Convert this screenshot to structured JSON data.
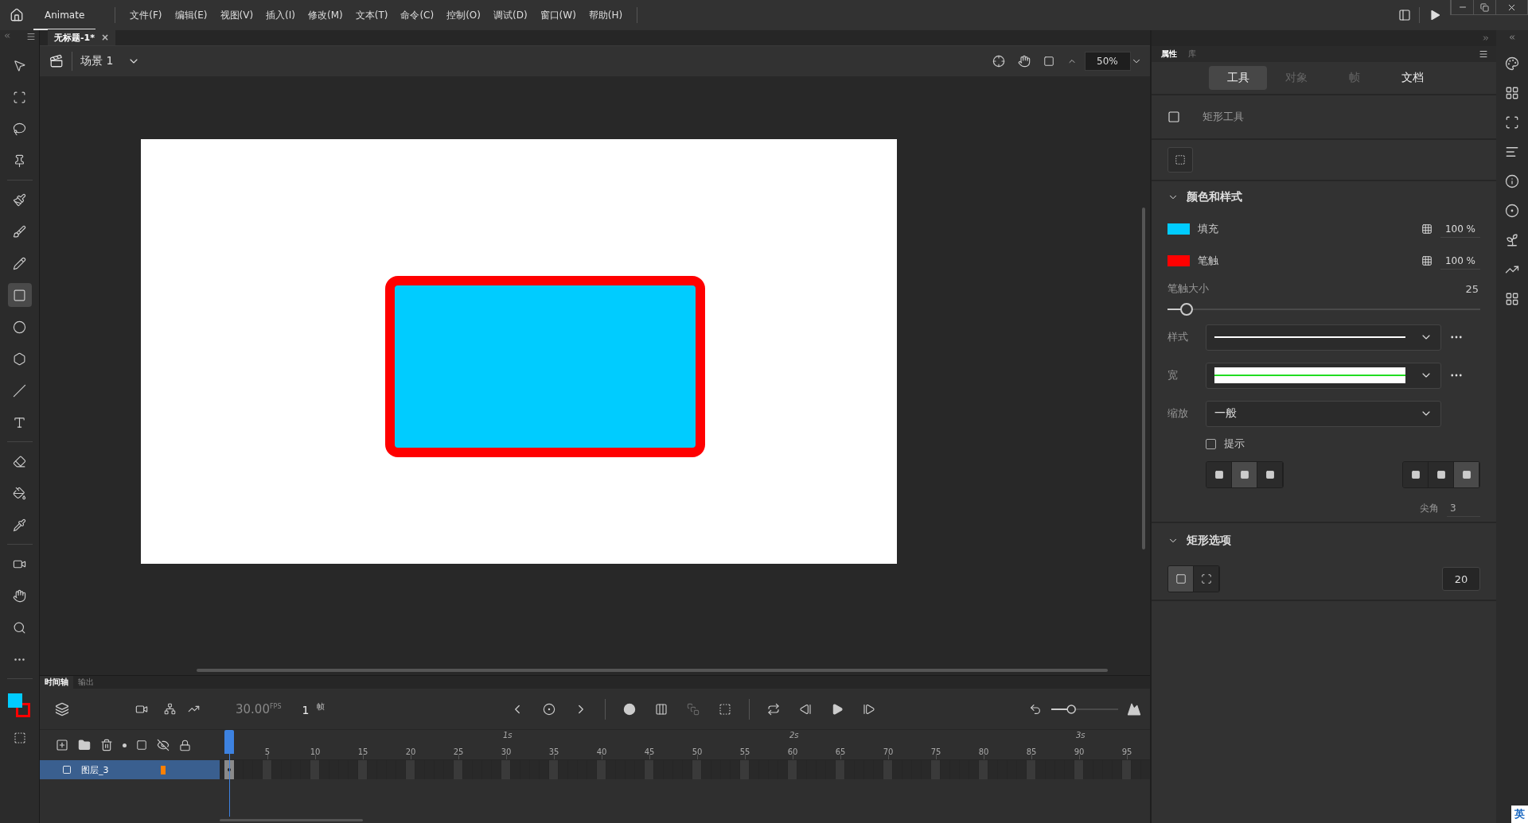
{
  "app": {
    "name": "Animate"
  },
  "menu": [
    "文件(F)",
    "编辑(E)",
    "视图(V)",
    "插入(I)",
    "修改(M)",
    "文本(T)",
    "命令(C)",
    "控制(O)",
    "调试(D)",
    "窗口(W)",
    "帮助(H)"
  ],
  "document_tab": {
    "title": "无标题-1*",
    "close": "×"
  },
  "scene": {
    "label": "场景 1"
  },
  "zoom": {
    "value": "50%"
  },
  "tool_groups": [
    {
      "tools": [
        {
          "kind": "select",
          "selected": false
        },
        {
          "kind": "transform",
          "selected": false
        },
        {
          "kind": "lasso",
          "selected": false
        },
        {
          "kind": "pin",
          "selected": false
        }
      ]
    },
    {
      "tools": [
        {
          "kind": "paintbrush",
          "selected": false
        },
        {
          "kind": "brush",
          "selected": false
        },
        {
          "kind": "pencil",
          "selected": false
        },
        {
          "kind": "rectangle",
          "selected": true
        },
        {
          "kind": "oval",
          "selected": false
        },
        {
          "kind": "polystar",
          "selected": false
        },
        {
          "kind": "line",
          "selected": false
        },
        {
          "kind": "text",
          "selected": false
        }
      ]
    },
    {
      "tools": [
        {
          "kind": "eraser",
          "selected": false
        },
        {
          "kind": "bucket",
          "selected": false
        },
        {
          "kind": "eyedropper",
          "selected": false
        }
      ]
    },
    {
      "tools": [
        {
          "kind": "camera",
          "selected": false
        },
        {
          "kind": "hand",
          "selected": false
        },
        {
          "kind": "zoom",
          "selected": false
        },
        {
          "kind": "more",
          "selected": false
        }
      ]
    }
  ],
  "panel_tabs": [
    {
      "label": "属性",
      "selected": true
    },
    {
      "label": "库",
      "selected": false
    }
  ],
  "property_tabs": [
    {
      "label": "工具",
      "selected": true,
      "disabled": false
    },
    {
      "label": "对象",
      "selected": false,
      "disabled": true
    },
    {
      "label": "帧",
      "selected": false,
      "disabled": true
    },
    {
      "label": "文档",
      "selected": false,
      "disabled": false
    }
  ],
  "tool_name": "矩形工具",
  "color_section": {
    "title": "颜色和样式",
    "expanded": true,
    "fill": {
      "label": "填充",
      "color": "#00ccff",
      "alpha": "100 %"
    },
    "stroke": {
      "label": "笔触",
      "color": "#ff0000",
      "alpha": "100 %"
    },
    "stroke_size": {
      "label": "笔触大小",
      "value": "25",
      "level": 0.06
    },
    "style": {
      "label": "样式"
    },
    "width": {
      "label": "宽"
    },
    "scale": {
      "label": "缩放",
      "value": "一般"
    },
    "hint": {
      "label": "提示",
      "checked": false
    },
    "caps": [
      {
        "selected": false
      },
      {
        "selected": true
      },
      {
        "selected": false
      }
    ],
    "joins": [
      {
        "selected": false
      },
      {
        "selected": false
      },
      {
        "selected": true
      }
    ],
    "miter": {
      "label": "尖角",
      "value": "3"
    }
  },
  "rect_section": {
    "title": "矩形选项",
    "expanded": true,
    "corner_modes": [
      {
        "selected": true
      },
      {
        "selected": false
      }
    ],
    "radius": "20"
  },
  "timeline": {
    "tabs": [
      {
        "label": "时间轴",
        "selected": true
      },
      {
        "label": "输出",
        "selected": false
      }
    ],
    "zoom_slider": {
      "level": 0.3
    },
    "fps": "30.00",
    "fps_unit": "FPS",
    "frame": "1",
    "frame_unit": "帧",
    "seconds": [
      "1s",
      "2s",
      "3s"
    ],
    "frame_numbers": [
      "5",
      "10",
      "15",
      "20",
      "25",
      "30",
      "35",
      "40",
      "45",
      "50",
      "55",
      "60",
      "65",
      "70",
      "75",
      "80",
      "85",
      "90",
      "95"
    ],
    "layers": [
      {
        "name": "图层_3",
        "selected": true,
        "color": "#ff8000"
      }
    ]
  },
  "ime": {
    "mode": "英"
  }
}
